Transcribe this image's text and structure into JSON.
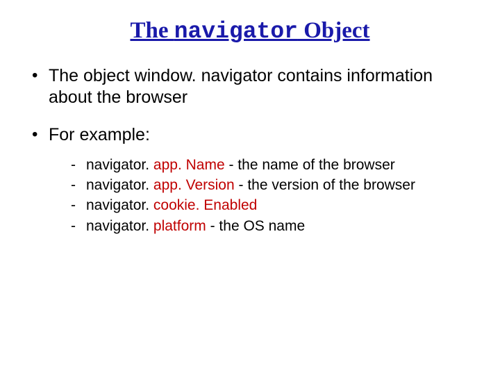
{
  "title": {
    "prefix": "The ",
    "code": "navigator",
    "suffix": " Object"
  },
  "bullets": {
    "b1": "The object window. navigator contains information about the browser",
    "b2": "For example:"
  },
  "sub": [
    {
      "obj": "navigator. ",
      "prop": "app. Name",
      "rest": " - the name of the browser"
    },
    {
      "obj": "navigator. ",
      "prop": "app. Version",
      "rest": " - the version of the browser"
    },
    {
      "obj": "navigator. ",
      "prop": "cookie. Enabled",
      "rest": ""
    },
    {
      "obj": "navigator. ",
      "prop": "platform",
      "rest": " - the OS name"
    }
  ]
}
